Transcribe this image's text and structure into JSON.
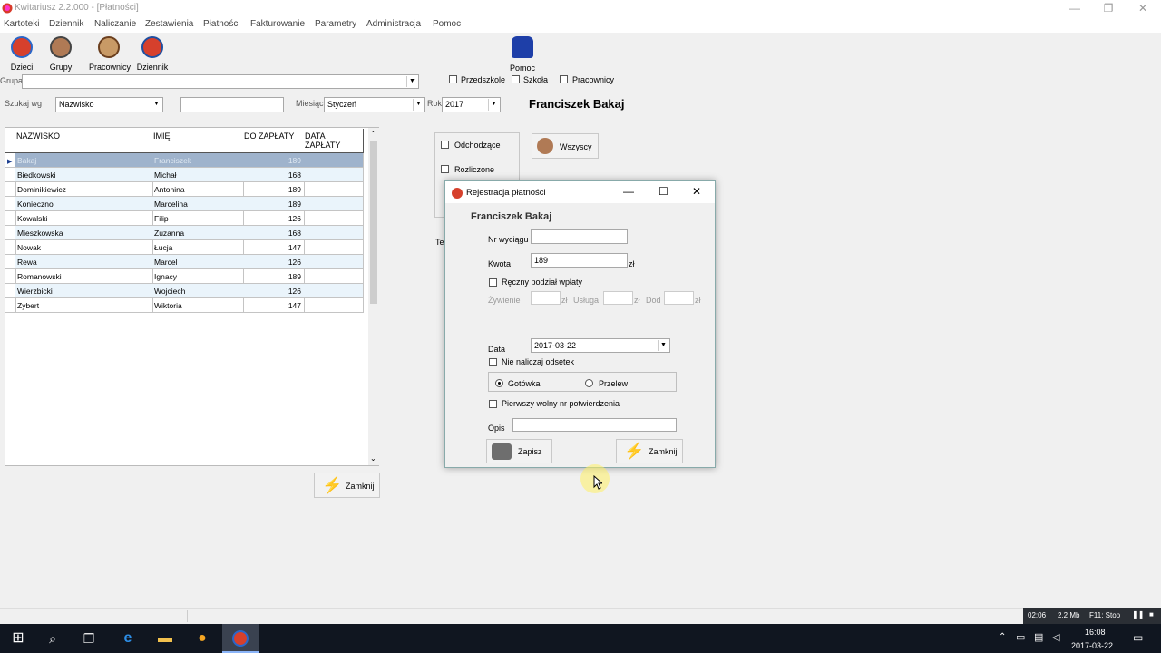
{
  "window": {
    "title": "Kwitariusz 2.2.000 - [Płatności]"
  },
  "menu": [
    "Kartoteki",
    "Dziennik",
    "Naliczanie",
    "Zestawienia",
    "Płatności",
    "Fakturowanie",
    "Parametry",
    "Administracja",
    "Pomoc"
  ],
  "toolbar": [
    "Dzieci",
    "Grupy",
    "Pracownicy",
    "Dziennik",
    "Pomoc"
  ],
  "filters": {
    "grupa_label": "Grupa",
    "przedszkole": "Przedszkole",
    "szkola": "Szkoła",
    "pracownicy": "Pracownicy",
    "szukaj_label": "Szukaj wg",
    "szukaj_value": "Nazwisko",
    "miesiac_label": "Miesiąc",
    "miesiac_value": "Styczeń",
    "rok_label": "Rok",
    "rok_value": "2017"
  },
  "selected_person": "Franciszek Bakaj",
  "grid": {
    "headers": [
      "NAZWISKO",
      "IMIĘ",
      "DO ZAPŁATY",
      "DATA ZAPŁATY"
    ],
    "rows": [
      [
        "Bakaj",
        "Franciszek",
        "189",
        ""
      ],
      [
        "Biedkowski",
        "Michał",
        "168",
        ""
      ],
      [
        "Dominikiewicz",
        "Antonina",
        "189",
        ""
      ],
      [
        "Konieczno",
        "Marcelina",
        "189",
        ""
      ],
      [
        "Kowalski",
        "Filip",
        "126",
        ""
      ],
      [
        "Mieszkowska",
        "Zuzanna",
        "168",
        ""
      ],
      [
        "Nowak",
        "Łucja",
        "147",
        ""
      ],
      [
        "Rewa",
        "Marcel",
        "126",
        ""
      ],
      [
        "Romanowski",
        "Ignacy",
        "189",
        ""
      ],
      [
        "Wierzbicki",
        "Wojciech",
        "126",
        ""
      ],
      [
        "Zybert",
        "Wiktoria",
        "147",
        ""
      ]
    ]
  },
  "right_panel": {
    "odchodzace": "Odchodzące",
    "rozliczone": "Rozliczone",
    "wszyscy": "Wszyscy",
    "te_fragment": "Te"
  },
  "main_close": "Zamknij",
  "dialog": {
    "title": "Rejestracja płatności",
    "person": "Franciszek Bakaj",
    "nr_label": "Nr wyciągu",
    "nr_value": "",
    "kwota_label": "Kwota",
    "kwota_value": "189",
    "zl": "zł",
    "reczny": "Ręczny podział wpłaty",
    "zywienie": "Żywienie",
    "usluga": "Usługa",
    "dod": "Dod",
    "data_label": "Data",
    "data_value": "2017-03-22",
    "nie_naliczaj": "Nie naliczaj odsetek",
    "gotowka": "Gotówka",
    "przelew": "Przelew",
    "pierwszy": "Pierwszy wolny nr potwierdzenia",
    "opis_label": "Opis",
    "opis_value": "",
    "zapisz": "Zapisz",
    "zamknij": "Zamknij"
  },
  "status": {
    "time": "02:06",
    "size": "2.2 Mb",
    "f11": "F11: Stop"
  },
  "clock": {
    "time": "16:08",
    "date": "2017-03-22"
  }
}
